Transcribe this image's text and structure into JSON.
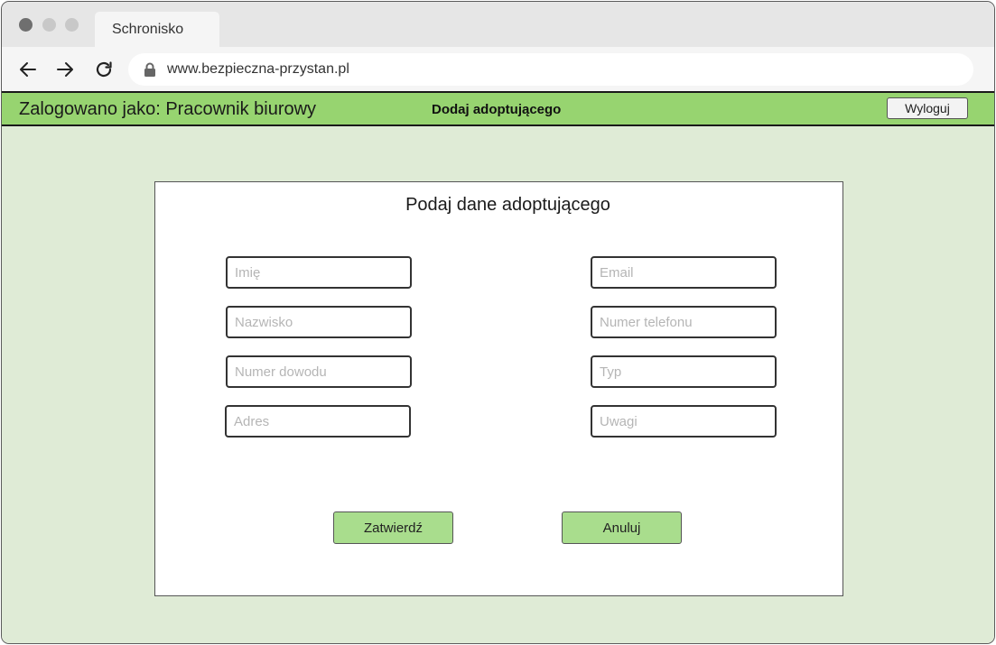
{
  "browser": {
    "tab_title": "Schronisko",
    "url": "www.bezpieczna-przystan.pl",
    "icons": {
      "back": "arrow-left",
      "forward": "arrow-right",
      "reload": "reload",
      "lock": "lock"
    }
  },
  "header": {
    "user_label": "Zalogowano jako: Pracownik biurowy",
    "page_title": "Dodaj adoptującego",
    "logout_label": "Wyloguj"
  },
  "form": {
    "title": "Podaj dane adoptującego",
    "fields": {
      "first_name": {
        "placeholder": "Imię",
        "value": ""
      },
      "last_name": {
        "placeholder": "Nazwisko",
        "value": ""
      },
      "id_number": {
        "placeholder": "Numer dowodu",
        "value": ""
      },
      "address": {
        "placeholder": "Adres",
        "value": ""
      },
      "email": {
        "placeholder": "Email",
        "value": ""
      },
      "phone": {
        "placeholder": "Numer telefonu",
        "value": ""
      },
      "type": {
        "placeholder": "Typ",
        "value": ""
      },
      "notes": {
        "placeholder": "Uwagi",
        "value": ""
      }
    },
    "submit_label": "Zatwierdź",
    "cancel_label": "Anuluj"
  },
  "colors": {
    "header_green": "#97d470",
    "content_bg": "#dfebd6",
    "button_green": "#a9dd8d"
  }
}
